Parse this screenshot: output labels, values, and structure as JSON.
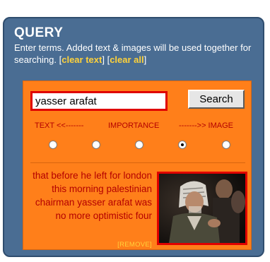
{
  "query": {
    "title": "QUERY",
    "description": "Enter terms. Added text & images will be used together for searching.",
    "bracket_open_1": "[",
    "clear_text_link": "clear text",
    "bracket_close_1": "]",
    "bracket_open_2": "[",
    "clear_all_link": "clear all",
    "bracket_close_2": "]"
  },
  "search": {
    "input_value": "yasser arafat",
    "button_label": "Search"
  },
  "importance": {
    "text_label": "TEXT <<-------",
    "middle_label": "IMPORTANCE",
    "image_label": "------->> IMAGE",
    "options_count": 5,
    "selected_index": 3
  },
  "result": {
    "snippet": "that before he left for london this morning palestinian chairman yasser arafat was no more optimistic four",
    "remove_label": "[REMOVE]",
    "image_icon": "news-video-frame"
  },
  "colors": {
    "panel_blue": "#4a6d93",
    "orange": "#ff7f1a",
    "red_text": "#b40000",
    "link_yellow": "#ffd23a",
    "border_red": "#e00000"
  }
}
